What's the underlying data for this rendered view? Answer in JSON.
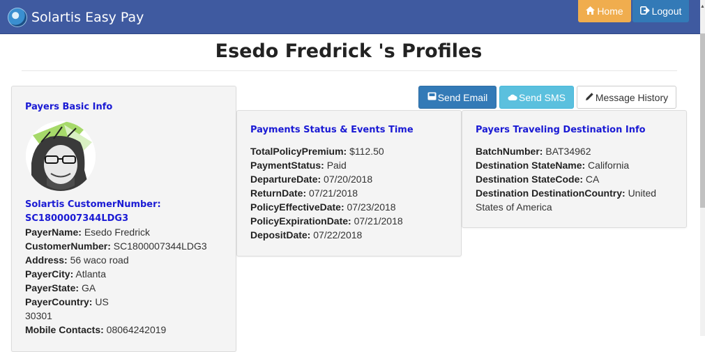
{
  "navbar": {
    "brand": "Solartis Easy Pay",
    "home_label": "Home",
    "logout_label": "Logout"
  },
  "page": {
    "title": "Esedo Fredrick 's Profiles"
  },
  "actions": {
    "send_email": "Send Email",
    "send_sms": "Send SMS",
    "message_history": "Message History"
  },
  "basic_info": {
    "heading": "Payers Basic Info",
    "customer_number_heading": "Solartis CustomerNumber: SC1800007344LDG3",
    "fields": [
      {
        "label": "PayerName:",
        "value": "Esedo Fredrick"
      },
      {
        "label": "CustomerNumber:",
        "value": "SC1800007344LDG3"
      },
      {
        "label": "Address:",
        "value": "56 waco road"
      },
      {
        "label": "PayerCity:",
        "value": "Atlanta"
      },
      {
        "label": "PayerState:",
        "value": "GA"
      },
      {
        "label": "PayerCountry:",
        "value": "US"
      }
    ],
    "zip": "30301",
    "mobile_label": "Mobile Contacts:",
    "mobile_value": "08064242019"
  },
  "payment_status": {
    "heading": "Payments Status & Events Time",
    "fields": [
      {
        "label": "TotalPolicyPremium:",
        "value": "$112.50"
      },
      {
        "label": "PaymentStatus:",
        "value": "Paid"
      },
      {
        "label": "DepartureDate:",
        "value": "07/20/2018"
      },
      {
        "label": "ReturnDate:",
        "value": "07/21/2018"
      },
      {
        "label": "PolicyEffectiveDate:",
        "value": "07/23/2018"
      },
      {
        "label": "PolicyExpirationDate:",
        "value": "07/21/2018"
      },
      {
        "label": "DepositDate:",
        "value": "07/22/2018"
      }
    ]
  },
  "destination": {
    "heading": "Payers Traveling Destination Info",
    "fields": [
      {
        "label": "BatchNumber:",
        "value": "BAT34962"
      },
      {
        "label": "Destination StateName:",
        "value": "California"
      },
      {
        "label": "Destination StateCode:",
        "value": "CA"
      },
      {
        "label": "Destination DestinationCountry:",
        "value": "United States of America"
      }
    ]
  },
  "colors": {
    "navbar": "#3f5aa0",
    "home_button": "#f0ad4e",
    "primary_button": "#337ab7",
    "info_button": "#5bc0de",
    "heading_blue": "#1a1ad4"
  },
  "icons": {
    "home": "home-icon",
    "logout": "logout-icon",
    "email": "inbox-icon",
    "sms": "cloud-icon",
    "history": "pencil-icon",
    "brand": "globe-logo"
  }
}
